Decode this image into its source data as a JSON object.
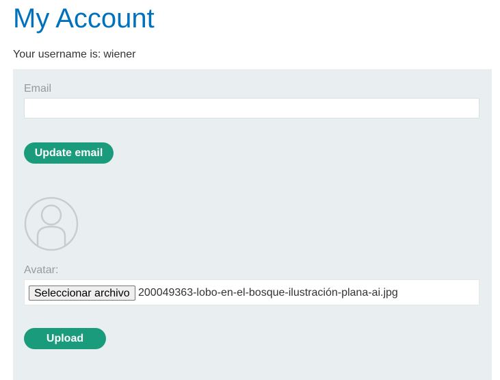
{
  "page": {
    "title": "My Account",
    "username_label": "Your username is:",
    "username": "wiener"
  },
  "email_form": {
    "label": "Email",
    "value": "",
    "button_label": "Update email"
  },
  "avatar_form": {
    "avatar_icon": "user-placeholder-icon",
    "label": "Avatar:",
    "file_button_label": "Seleccionar archivo",
    "file_name": "200049363-lobo-en-el-bosque-ilustración-plana-ai.jpg",
    "upload_label": "Upload"
  },
  "colors": {
    "title": "#0071bc",
    "panel_background": "#e9eff1",
    "button": "#1a9c7c",
    "label": "#999999"
  }
}
